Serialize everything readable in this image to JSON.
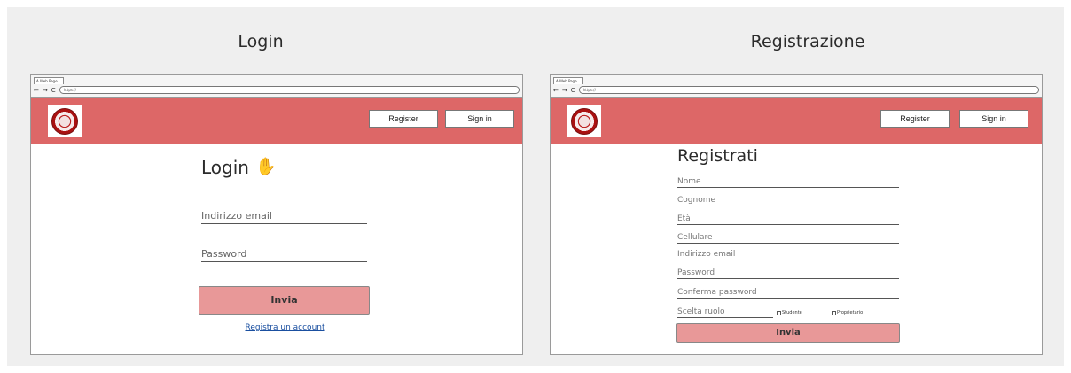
{
  "boards": {
    "login_title": "Login",
    "register_title": "Registrazione"
  },
  "browser": {
    "tab_label": "A Web Page",
    "back": "←",
    "forward": "→",
    "reload": "C",
    "url": "https://"
  },
  "header": {
    "register_label": "Register",
    "signin_label": "Sign in"
  },
  "login": {
    "heading": "Login",
    "wave_icon": "✋",
    "email_placeholder": "Indirizzo email",
    "password_placeholder": "Password",
    "submit_label": "Invia",
    "register_link": "Registra un account"
  },
  "registration": {
    "heading": "Registrati",
    "fields": [
      "Nome",
      "Cognome",
      "Età",
      "Cellulare",
      "Indirizzo email",
      "Password",
      "Conferma password"
    ],
    "role_placeholder": "Scelta ruolo",
    "role_options": [
      "Studente",
      "Proprietario"
    ],
    "submit_label": "Invia"
  },
  "colors": {
    "header": "#dd6767",
    "button": "#e89898",
    "link": "#1a4fa0",
    "background": "#efefef"
  }
}
